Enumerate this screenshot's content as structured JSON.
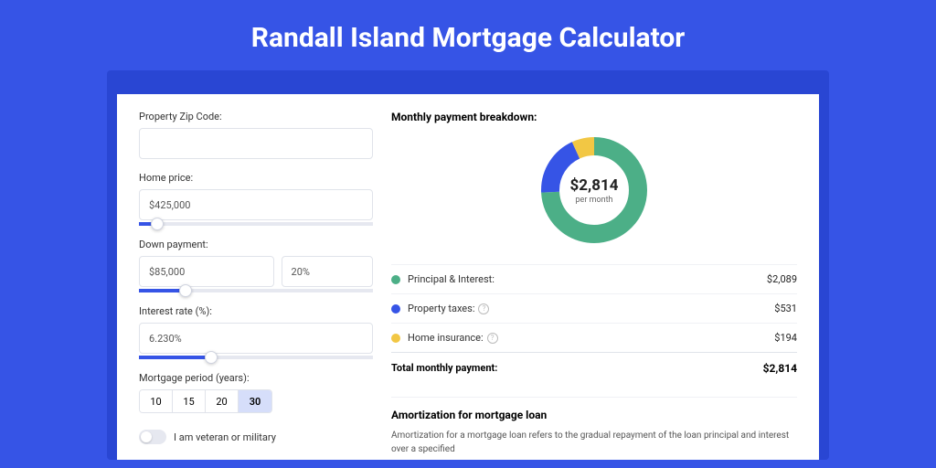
{
  "title": "Randall Island Mortgage Calculator",
  "form": {
    "zip": {
      "label": "Property Zip Code:",
      "value": ""
    },
    "price": {
      "label": "Home price:",
      "value": "$425,000",
      "slider_pct": 8
    },
    "down": {
      "label": "Down payment:",
      "value": "$85,000",
      "pct": "20%",
      "slider_pct": 20
    },
    "rate": {
      "label": "Interest rate (%):",
      "value": "6.230%",
      "slider_pct": 31
    },
    "period": {
      "label": "Mortgage period (years):",
      "options": [
        "10",
        "15",
        "20",
        "30"
      ],
      "selected": "30"
    },
    "veteran": {
      "label": "I am veteran or military",
      "checked": false
    }
  },
  "breakdown": {
    "title": "Monthly payment breakdown:",
    "center_value": "$2,814",
    "center_sub": "per month",
    "rows": [
      {
        "label": "Principal & Interest:",
        "value": "$2,089",
        "color": "#4caf87",
        "info": false
      },
      {
        "label": "Property taxes:",
        "value": "$531",
        "color": "#3654e6",
        "info": true
      },
      {
        "label": "Home insurance:",
        "value": "$194",
        "color": "#f2c744",
        "info": true
      }
    ],
    "total_label": "Total monthly payment:",
    "total_value": "$2,814"
  },
  "amort": {
    "title": "Amortization for mortgage loan",
    "text": "Amortization for a mortgage loan refers to the gradual repayment of the loan principal and interest over a specified"
  },
  "chart_data": {
    "type": "pie",
    "title": "Monthly payment breakdown",
    "series": [
      {
        "name": "Principal & Interest",
        "value": 2089,
        "color": "#4caf87"
      },
      {
        "name": "Property taxes",
        "value": 531,
        "color": "#3654e6"
      },
      {
        "name": "Home insurance",
        "value": 194,
        "color": "#f2c744"
      }
    ],
    "total": 2814,
    "center_label": "$2,814 per month"
  }
}
